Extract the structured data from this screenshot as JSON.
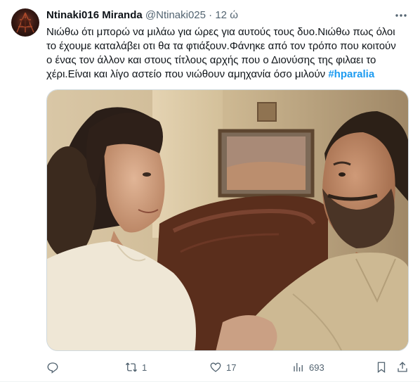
{
  "tweet": {
    "display_name": "Ntinaki016 Miranda",
    "handle": "@Ntinaki025",
    "separator": "·",
    "timestamp": "12 ώ",
    "text_lines": [
      "Νιώθω ότι μπορώ να μιλάω για ώρες για αυτούς τους δυο.Νιώθω πως όλοι",
      "το έχουμε καταλάβει οτι θα τα φτιάξουν.Φάνηκε από τον τρόπο που κοιτούν",
      "ο ένας τον άλλον και στους τίτλους αρχής που ο Διονύσης της φιλαει το",
      "χέρι.Είναι και λίγο αστείο που νιώθουν αμηχανία όσο μιλούν "
    ],
    "hashtag": "#hparalia",
    "more_icon": "more-horizontal-icon",
    "media_description_icon": "photo"
  },
  "actions": {
    "reply": {
      "icon": "reply-icon",
      "count": ""
    },
    "retweet": {
      "icon": "retweet-icon",
      "count": "1"
    },
    "like": {
      "icon": "heart-icon",
      "count": "17"
    },
    "views": {
      "icon": "views-icon",
      "count": "693"
    },
    "bookmark": {
      "icon": "bookmark-icon"
    },
    "share": {
      "icon": "share-icon"
    }
  },
  "colors": {
    "text": "#0f1419",
    "secondary": "#536471",
    "link": "#1d9bf0",
    "border": "#cfd9de"
  }
}
